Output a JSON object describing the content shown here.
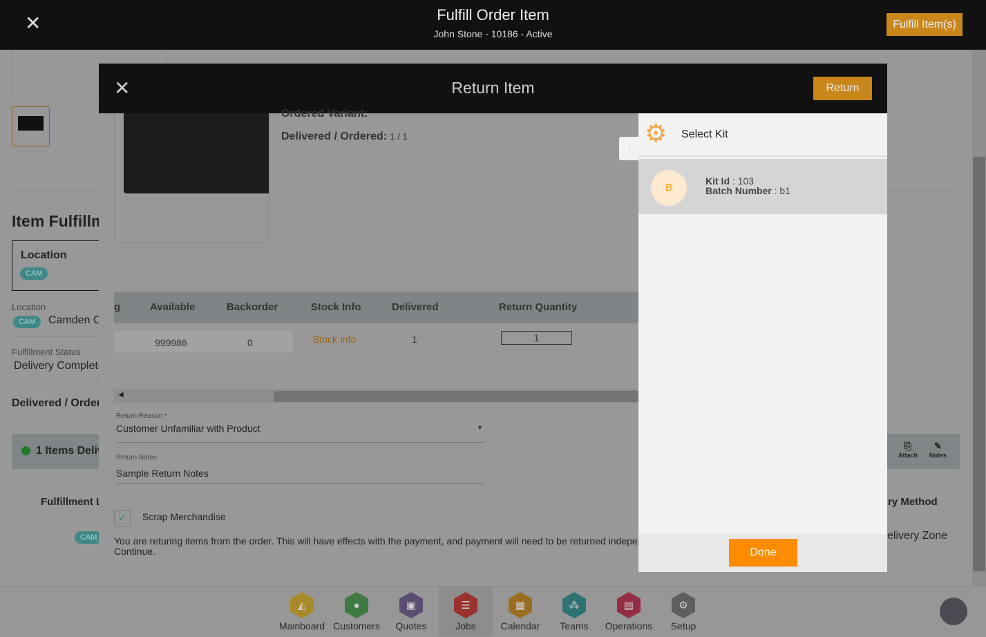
{
  "topbar": {
    "title": "Fulfill Order Item",
    "subtitle": "John Stone - 10186 - Active",
    "fulfill_button": "Fulfill Item(s)"
  },
  "background": {
    "section_title": "Item Fulfillm",
    "location_card_label": "Location",
    "location_badge": "CAM",
    "location_label": "Location",
    "location_value": "Camden C",
    "status_label": "Fulfillment Status",
    "status_value": "Delivery Complete",
    "delivered_ordered": "Delivered / Order",
    "items_delivered": "1 Items Deliv",
    "attach": "Attach",
    "notes": "Notes",
    "fulfillment_col": "Fulfillment L",
    "delivery_method": "ry Method",
    "delivery_zone": "elivery Zone",
    "cam2": "CAM"
  },
  "modal": {
    "title": "Return Item",
    "return_button": "Return",
    "ordered_variant": "Ordered Variant:",
    "delivered_ordered_label": "Delivered / Ordered:",
    "delivered_ordered_value": "1 / 1",
    "table": {
      "headers": [
        "g",
        "Available",
        "Backorder",
        "Stock Info",
        "Delivered",
        "Return Quantity"
      ],
      "row": {
        "available": "999986",
        "backorder": "0",
        "stock_info": "Stock Info",
        "delivered": "1",
        "return_quantity": "1"
      }
    },
    "return_reason_label": "Return Reason *",
    "return_reason_value": "Customer Unfamiliar with Product",
    "return_notes_label": "Return Notes",
    "return_notes_value": "Sample Return Notes",
    "scrap_label": "Scrap Merchandise",
    "scrap_checked": true,
    "warning": "You are returing items from the order. This will have effects with the payment, and payment will need to be returned independen",
    "warning2": "Continue."
  },
  "kit_panel": {
    "title": "Select Kit",
    "items": [
      {
        "avatar": "B",
        "kit_id_label": "Kit Id",
        "kit_id": "103",
        "batch_label": "Batch Number",
        "batch": "b1"
      }
    ],
    "done_button": "Done"
  },
  "nav": {
    "items": [
      {
        "label": "Mainboard",
        "color": "#a88a2a"
      },
      {
        "label": "Customers",
        "color": "#3f7a43"
      },
      {
        "label": "Quotes",
        "color": "#5c4d72"
      },
      {
        "label": "Jobs",
        "color": "#9a3330"
      },
      {
        "label": "Calendar",
        "color": "#9a6d20"
      },
      {
        "label": "Teams",
        "color": "#2f7272"
      },
      {
        "label": "Operations",
        "color": "#952e44"
      },
      {
        "label": "Setup",
        "color": "#5e5e5e"
      }
    ],
    "active": "Jobs"
  }
}
